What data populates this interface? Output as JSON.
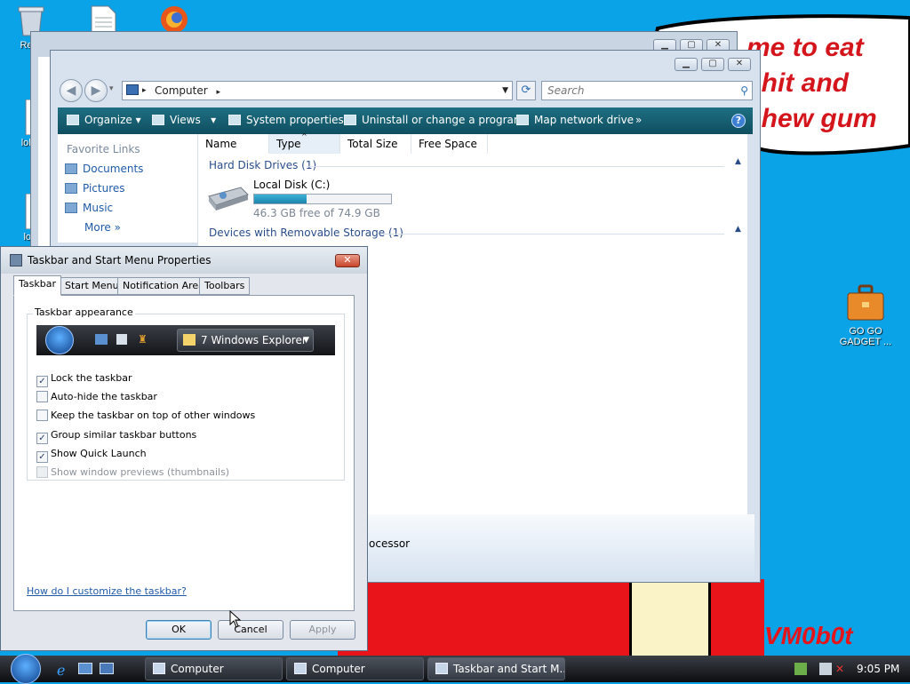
{
  "desktop": {
    "icons": [
      {
        "label": "Recy"
      },
      {
        "label": "loldc"
      },
      {
        "label": "lold"
      },
      {
        "label": "GO GO GADGET ..."
      }
    ],
    "speech_text": "me to eat shit and chew gum",
    "vmobot_text": "VM0b0t"
  },
  "explorer_back": {
    "title": ""
  },
  "explorer": {
    "address": "Computer",
    "search_placeholder": "Search",
    "toolbar": {
      "organize": "Organize",
      "views": "Views",
      "system_properties": "System properties",
      "uninstall": "Uninstall or change a program",
      "map_drive": "Map network drive",
      "more": "»"
    },
    "favorite_links": {
      "heading": "Favorite Links",
      "items": [
        "Documents",
        "Pictures",
        "Music"
      ],
      "more": "More"
    },
    "columns": [
      "Name",
      "Type",
      "Total Size",
      "Free Space"
    ],
    "groups": {
      "hdd": "Hard Disk Drives (1)",
      "removable": "Devices with Removable Storage (1)"
    },
    "drive": {
      "label": "Local Disk (C:)",
      "free_text": "46.3 GB free of 74.9 GB",
      "used_fraction": 0.38
    },
    "details_text": "ocessor"
  },
  "dialog": {
    "title": "Taskbar and Start Menu Properties",
    "tabs": [
      "Taskbar",
      "Start Menu",
      "Notification Area",
      "Toolbars"
    ],
    "appearance_legend": "Taskbar appearance",
    "preview_button": "7 Windows Explorer",
    "options": [
      {
        "label": "Lock the taskbar",
        "checked": true,
        "disabled": false
      },
      {
        "label": "Auto-hide the taskbar",
        "checked": false,
        "disabled": false
      },
      {
        "label": "Keep the taskbar on top of other windows",
        "checked": false,
        "disabled": false
      },
      {
        "label": "Group similar taskbar buttons",
        "checked": true,
        "disabled": false
      },
      {
        "label": "Show Quick Launch",
        "checked": true,
        "disabled": false
      },
      {
        "label": "Show window previews (thumbnails)",
        "checked": false,
        "disabled": true
      }
    ],
    "help_link": "How do I customize the taskbar?",
    "buttons": {
      "ok": "OK",
      "cancel": "Cancel",
      "apply": "Apply"
    }
  },
  "taskbar": {
    "buttons": [
      "Computer",
      "Computer",
      "Taskbar and Start M..."
    ],
    "clock": "9:05 PM"
  },
  "colors": {
    "desktop": "#0aa3e8",
    "speech_text": "#d4161c",
    "toolbar": "#1f6f82"
  }
}
